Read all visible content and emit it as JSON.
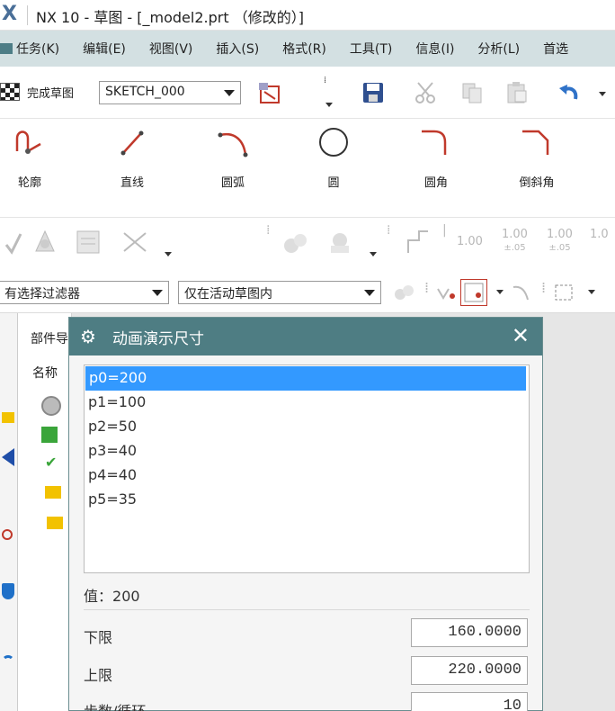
{
  "window": {
    "title": "NX 10 - 草图 - [_model2.prt （修改的）]",
    "logo": "X"
  },
  "menubar": {
    "items": [
      "任务(K)",
      "编辑(E)",
      "视图(V)",
      "插入(S)",
      "格式(R)",
      "工具(T)",
      "信息(I)",
      "分析(L)",
      "首选"
    ]
  },
  "toolbar": {
    "finish_sketch": "完成草图",
    "sketch_name": "SKETCH_000"
  },
  "ribbon": {
    "tools": [
      {
        "label": "轮廓",
        "icon": "profile-icon"
      },
      {
        "label": "直线",
        "icon": "line-icon"
      },
      {
        "label": "圆弧",
        "icon": "arc-icon"
      },
      {
        "label": "圆",
        "icon": "circle-icon"
      },
      {
        "label": "圆角",
        "icon": "fillet-icon"
      },
      {
        "label": "倒斜角",
        "icon": "chamfer-icon"
      }
    ]
  },
  "toolbar3": {
    "dim_values": [
      "1.00",
      "1.00",
      "1.00",
      "1.0"
    ],
    "dim_sub": [
      "±.05",
      "±.05"
    ]
  },
  "filterbar": {
    "selection_filter": "有选择过滤器",
    "scope": "仅在活动草图内"
  },
  "navigator": {
    "tab": "部件导",
    "column": "名称"
  },
  "dialog": {
    "title": "动画演示尺寸",
    "params": [
      "p0=200",
      "p1=100",
      "p2=50",
      "p3=40",
      "p4=40",
      "p5=35"
    ],
    "selected_index": 0,
    "value_label": "值：",
    "value": "200",
    "lower_label": "下限",
    "lower_value": "160.0000",
    "upper_label": "上限",
    "upper_value": "220.0000",
    "steps_label": "步数/循环",
    "steps_value": "10"
  }
}
